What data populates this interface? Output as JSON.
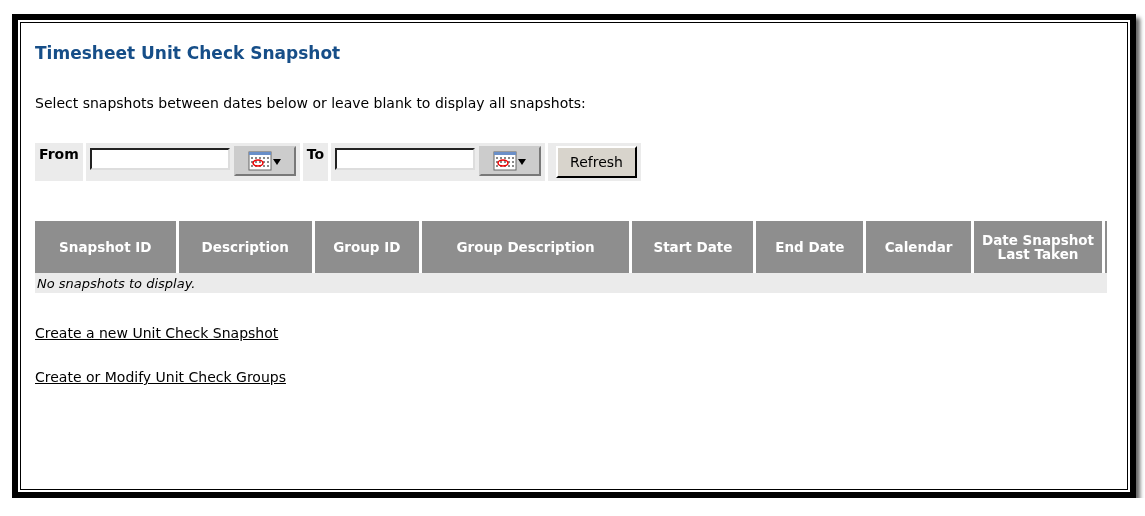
{
  "title": "Timesheet Unit Check Snapshot",
  "instructions": "Select snapshots between dates below or leave blank to display all snapshots:",
  "filters": [
    {
      "label": "From"
    },
    {
      "label": "To"
    }
  ],
  "refresh_button": "Refresh",
  "table": {
    "columns": [
      "Snapshot ID",
      "Description",
      "Group ID",
      "Group Description",
      "Start Date",
      "End Date",
      "Calendar",
      "Date Snapshot Last Taken"
    ],
    "empty_message": "No snapshots to display."
  },
  "links": [
    "Create a new Unit Check Snapshot",
    "Create or Modify Unit Check Groups"
  ]
}
